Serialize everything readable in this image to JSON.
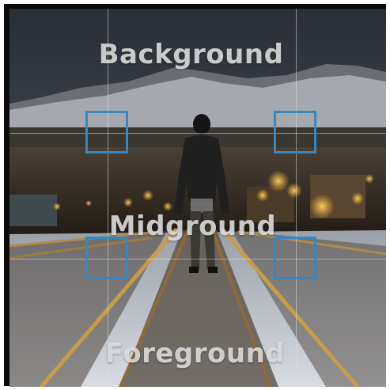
{
  "labels": {
    "background": "Background",
    "midground": "Midground",
    "foreground": "Foreground"
  },
  "colors": {
    "marker": "#3a87c0",
    "grid": "#dcdcdc",
    "sky": "#2e323c",
    "snow": "#c9cdd4",
    "lights": "#f5b43c"
  },
  "scene": {
    "subject": "person-standing-on-railway-tracks",
    "setting": "snowy-tracks-at-night-with-town-lights-and-mountains"
  },
  "overlay": {
    "grid": "rule-of-thirds",
    "markers": [
      "top-left-intersection",
      "top-right-intersection",
      "bottom-left-intersection",
      "bottom-right-intersection"
    ]
  }
}
